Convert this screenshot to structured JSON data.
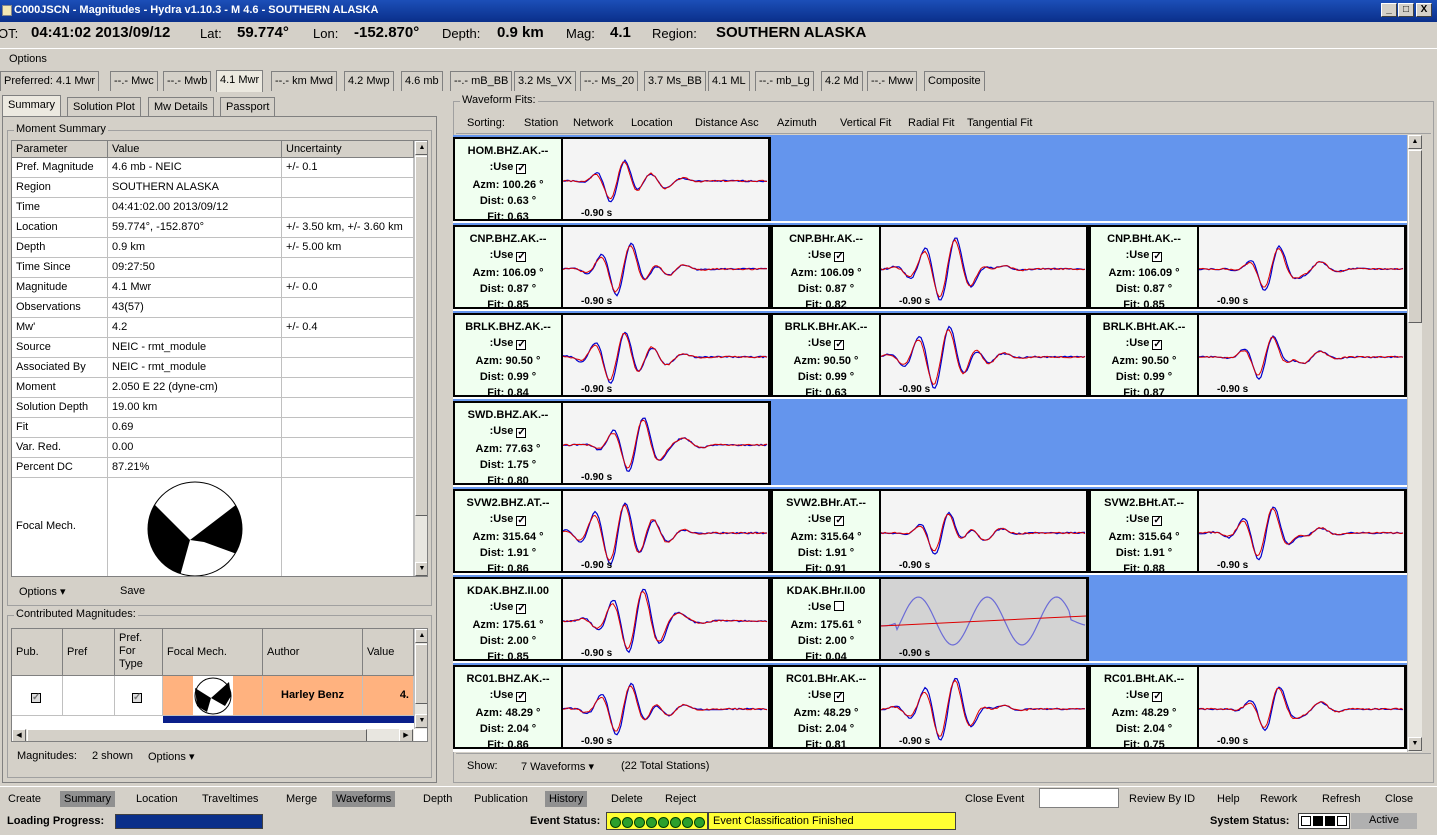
{
  "window": {
    "title": "C000JSCN - Magnitudes - Hydra v1.10.3 - M 4.6 - SOUTHERN ALASKA",
    "minimize": "_",
    "maximize": "□",
    "close": "X"
  },
  "info": {
    "ot_label": "OT:",
    "ot": "04:41:02 2013/09/12",
    "lat_label": "Lat:",
    "lat": "59.774°",
    "lon_label": "Lon:",
    "lon": "-152.870°",
    "depth_label": "Depth:",
    "depth": "0.9 km",
    "mag_label": "Mag:",
    "mag": "4.1",
    "region_label": "Region:",
    "region": "SOUTHERN ALASKA"
  },
  "menu": {
    "options": "Options"
  },
  "mag_tabs": [
    "Preferred: 4.1 Mwr",
    "--.- Mwc",
    "--.- Mwb",
    "4.1 Mwr",
    "--.- km Mwd",
    "4.2 Mwp",
    "4.6 mb",
    "--.- mB_BB",
    "3.2 Ms_VX",
    "--.- Ms_20",
    "3.7 Ms_BB",
    "4.1 ML",
    "--.- mb_Lg",
    "4.2 Md",
    "--.- Mww",
    "Composite"
  ],
  "sub_tabs": [
    "Summary",
    "Solution Plot",
    "Mw Details",
    "Passport"
  ],
  "moment": {
    "title": "Moment Summary",
    "headers": [
      "Parameter",
      "Value",
      "Uncertainty"
    ],
    "rows": [
      [
        "Pref. Magnitude",
        "4.6 mb - NEIC",
        "+/- 0.1"
      ],
      [
        "Region",
        "SOUTHERN ALASKA",
        ""
      ],
      [
        "Time",
        "04:41:02.00 2013/09/12",
        ""
      ],
      [
        "Location",
        "59.774°, -152.870°",
        "+/- 3.50 km, +/- 3.60 km"
      ],
      [
        "Depth",
        "0.9 km",
        "+/- 5.00 km"
      ],
      [
        "Time Since",
        "09:27:50",
        ""
      ],
      [
        "Magnitude",
        "4.1 Mwr",
        "+/- 0.0"
      ],
      [
        "Observations",
        "43(57)",
        ""
      ],
      [
        "Mw'",
        "4.2",
        "+/- 0.4"
      ],
      [
        "Source",
        "NEIC - rmt_module",
        ""
      ],
      [
        "Associated By",
        "NEIC - rmt_module",
        ""
      ],
      [
        "Moment",
        "2.050 E 22 (dyne-cm)",
        ""
      ],
      [
        "Solution Depth",
        "19.00 km",
        ""
      ],
      [
        "Fit",
        "0.69",
        ""
      ],
      [
        "Var. Red.",
        "0.00",
        ""
      ],
      [
        "Percent DC",
        "87.21%",
        ""
      ]
    ],
    "focal_label": "Focal Mech.",
    "options": "Options",
    "save": "Save"
  },
  "contrib": {
    "title": "Contributed Magnitudes:",
    "headers": [
      "Pub.",
      "Pref",
      "Pref. For Type",
      "Focal Mech.",
      "Author",
      "Value"
    ],
    "row": {
      "author": "Harley Benz",
      "value": "4."
    },
    "footer_label": "Magnitudes:",
    "footer_count": "2 shown",
    "footer_options": "Options"
  },
  "waveforms": {
    "title": "Waveform Fits:",
    "sorting": [
      "Sorting:",
      "Station",
      "Network",
      "Location",
      "Distance Asc",
      "Azimuth",
      "Vertical Fit",
      "Radial Fit",
      "Tangential Fit"
    ],
    "use": ":Use",
    "time": "-0.90 s",
    "cards": [
      {
        "name": "HOM.BHZ.AK.--",
        "azm": "Azm: 100.26 °",
        "dist": "Dist: 0.63 °",
        "fit": "Fit: 0.63"
      },
      {
        "name": "CNP.BHZ.AK.--",
        "azm": "Azm: 106.09 °",
        "dist": "Dist: 0.87 °",
        "fit": "Fit: 0.85"
      },
      {
        "name": "CNP.BHr.AK.--",
        "azm": "Azm: 106.09 °",
        "dist": "Dist: 0.87 °",
        "fit": "Fit: 0.82"
      },
      {
        "name": "CNP.BHt.AK.--",
        "azm": "Azm: 106.09 °",
        "dist": "Dist: 0.87 °",
        "fit": "Fit: 0.85"
      },
      {
        "name": "BRLK.BHZ.AK.--",
        "azm": "Azm: 90.50 °",
        "dist": "Dist: 0.99 °",
        "fit": "Fit: 0.84"
      },
      {
        "name": "BRLK.BHr.AK.--",
        "azm": "Azm: 90.50 °",
        "dist": "Dist: 0.99 °",
        "fit": "Fit: 0.63"
      },
      {
        "name": "BRLK.BHt.AK.--",
        "azm": "Azm: 90.50 °",
        "dist": "Dist: 0.99 °",
        "fit": "Fit: 0.87"
      },
      {
        "name": "SWD.BHZ.AK.--",
        "azm": "Azm: 77.63 °",
        "dist": "Dist: 1.75 °",
        "fit": "Fit: 0.80"
      },
      {
        "name": "SVW2.BHZ.AT.--",
        "azm": "Azm: 315.64 °",
        "dist": "Dist: 1.91 °",
        "fit": "Fit: 0.86"
      },
      {
        "name": "SVW2.BHr.AT.--",
        "azm": "Azm: 315.64 °",
        "dist": "Dist: 1.91 °",
        "fit": "Fit: 0.91"
      },
      {
        "name": "SVW2.BHt.AT.--",
        "azm": "Azm: 315.64 °",
        "dist": "Dist: 1.91 °",
        "fit": "Fit: 0.88"
      },
      {
        "name": "KDAK.BHZ.II.00",
        "azm": "Azm: 175.61 °",
        "dist": "Dist: 2.00 °",
        "fit": "Fit: 0.85"
      },
      {
        "name": "KDAK.BHr.II.00",
        "azm": "Azm: 175.61 °",
        "dist": "Dist: 2.00 °",
        "fit": "Fit: 0.04"
      },
      {
        "name": "RC01.BHZ.AK.--",
        "azm": "Azm: 48.29 °",
        "dist": "Dist: 2.04 °",
        "fit": "Fit: 0.86"
      },
      {
        "name": "RC01.BHr.AK.--",
        "azm": "Azm: 48.29 °",
        "dist": "Dist: 2.04 °",
        "fit": "Fit: 0.81"
      },
      {
        "name": "RC01.BHt.AK.--",
        "azm": "Azm: 48.29 °",
        "dist": "Dist: 2.04 °",
        "fit": "Fit: 0.75"
      }
    ],
    "show_label": "Show:",
    "show_value": "7 Waveforms",
    "total": "(22 Total Stations)"
  },
  "bottom": {
    "buttons": [
      "Create",
      "Summary",
      "Location",
      "Traveltimes",
      "Merge",
      "Waveforms",
      "Depth",
      "Publication",
      "History",
      "Delete",
      "Reject"
    ],
    "close_event": "Close Event",
    "review": "Review By ID",
    "help": "Help",
    "rework": "Rework",
    "refresh": "Refresh",
    "close": "Close"
  },
  "status": {
    "loading": "Loading Progress:",
    "event_status": "Event Status:",
    "event_msg": "Event Classification Finished",
    "system_status": "System Status:",
    "active": "Active"
  },
  "colors": {
    "observed": "#0000cc",
    "synthetic": "#dd0000",
    "row_bg": "#6495ed",
    "info_bg": "#f0fff0",
    "status_yellow": "#ffff33"
  }
}
